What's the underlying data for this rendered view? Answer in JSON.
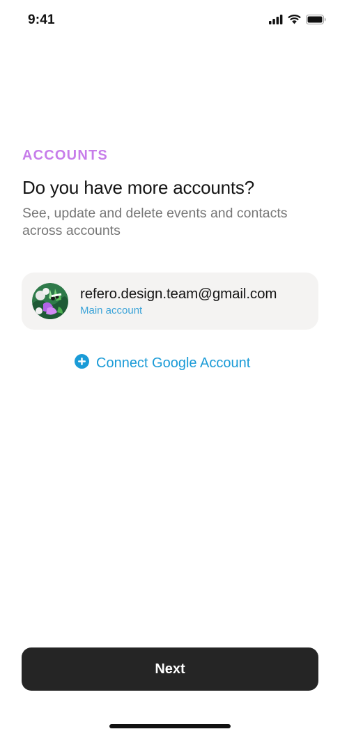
{
  "status_bar": {
    "time": "9:41",
    "icons": [
      "cellular-signal-icon",
      "wifi-icon",
      "battery-icon"
    ]
  },
  "header": {
    "eyebrow": "ACCOUNTS",
    "title": "Do you have more accounts?",
    "subtitle": "See, update and delete events and contacts across accounts"
  },
  "account": {
    "email": "refero.design.team@gmail.com",
    "label": "Main account"
  },
  "connect": {
    "label": "Connect Google Account",
    "icon": "plus-circle-icon"
  },
  "footer": {
    "next_label": "Next"
  },
  "colors": {
    "accent_purple": "#c77dea",
    "link_blue": "#1a9bd7",
    "button_dark": "#252525",
    "card_bg": "#f4f3f2"
  }
}
